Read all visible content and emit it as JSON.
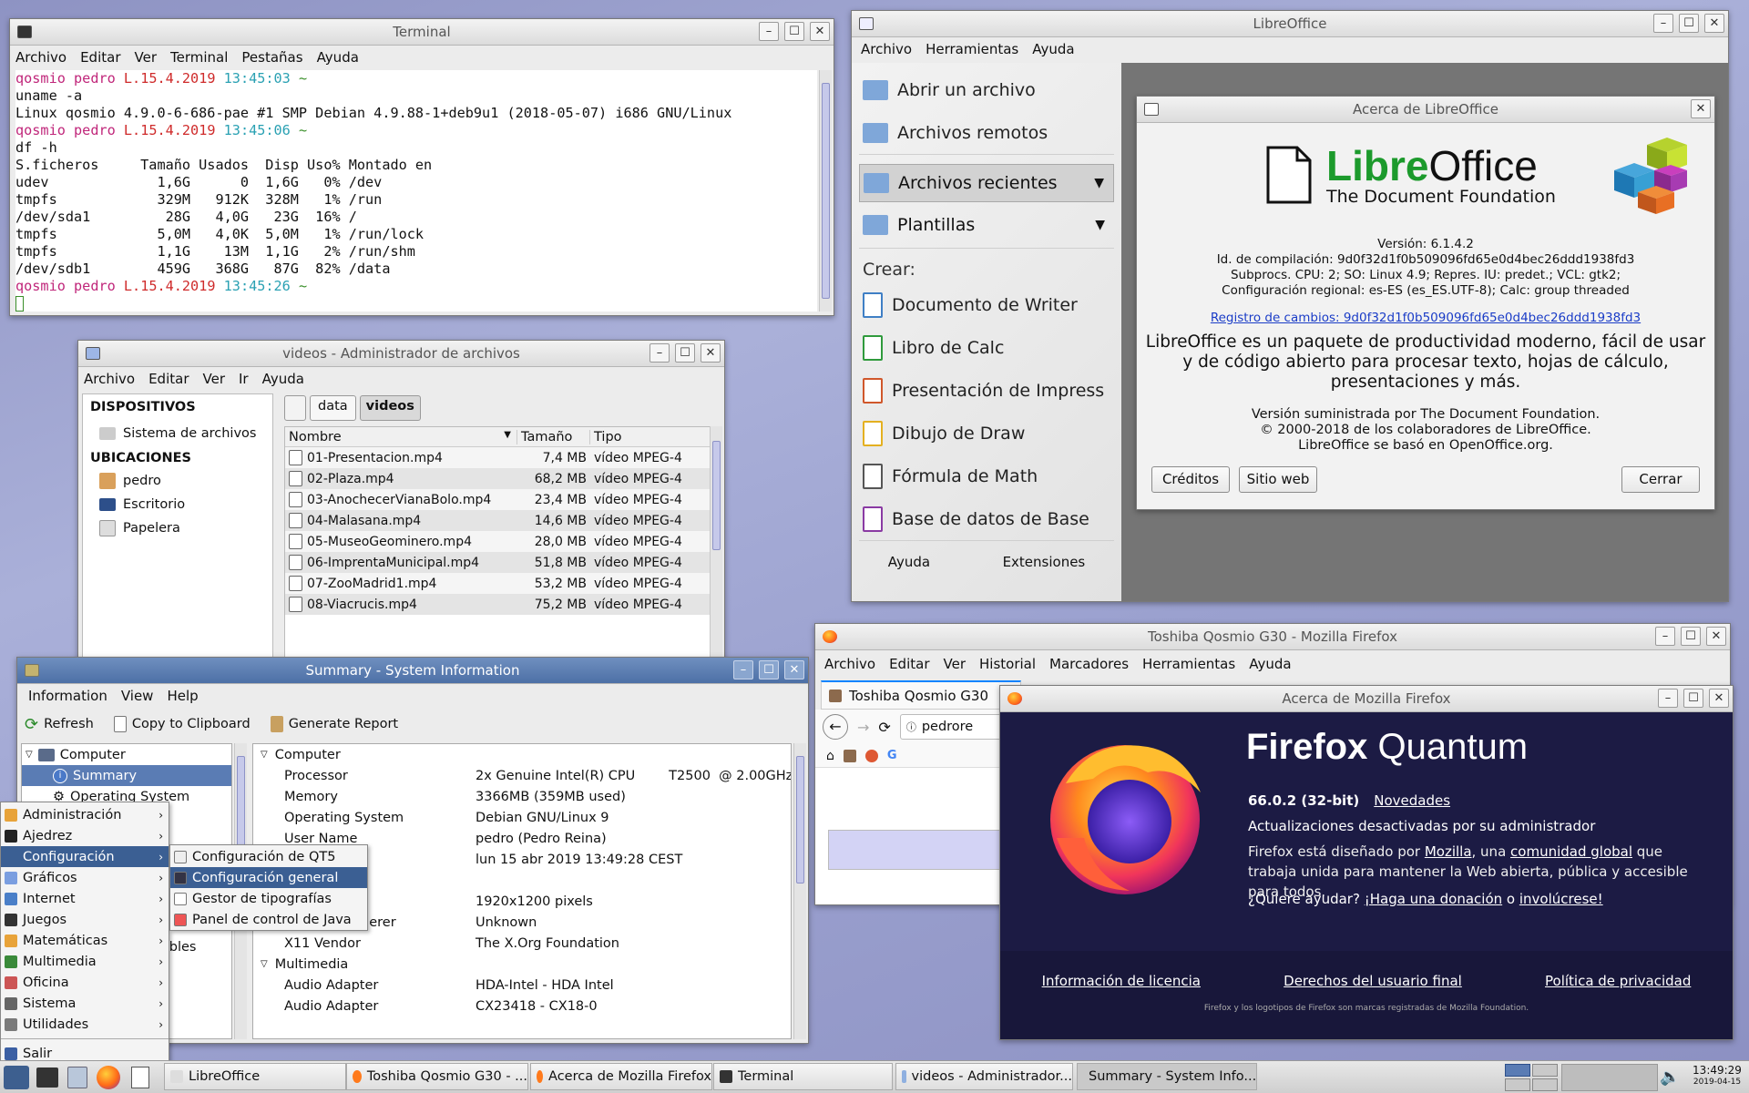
{
  "terminal": {
    "title": "Terminal",
    "menu": [
      "Archivo",
      "Editar",
      "Ver",
      "Terminal",
      "Pestañas",
      "Ayuda"
    ],
    "lines": [
      {
        "host": "qosmio",
        "user": "pedro",
        "tag": "L.15.4.2019",
        "time": "13:45:03",
        "dir": "~"
      },
      {
        "text": "uname -a"
      },
      {
        "text": "Linux qosmio 4.9.0-6-686-pae #1 SMP Debian 4.9.88-1+deb9u1 (2018-05-07) i686 GNU/Linux"
      },
      {
        "host": "qosmio",
        "user": "pedro",
        "tag": "L.15.4.2019",
        "time": "13:45:06",
        "dir": "~"
      },
      {
        "text": "df -h"
      },
      {
        "text": "S.ficheros     Tamaño Usados  Disp Uso% Montado en"
      },
      {
        "text": "udev             1,6G      0  1,6G   0% /dev"
      },
      {
        "text": "tmpfs            329M   912K  328M   1% /run"
      },
      {
        "text": "/dev/sda1         28G   4,0G   23G  16% /"
      },
      {
        "text": "tmpfs            5,0M   4,0K  5,0M   1% /run/lock"
      },
      {
        "text": "tmpfs            1,1G    13M  1,1G   2% /run/shm"
      },
      {
        "text": "/dev/sdb1        459G   368G   87G  82% /data"
      },
      {
        "host": "qosmio",
        "user": "pedro",
        "tag": "L.15.4.2019",
        "time": "13:45:26",
        "dir": "~"
      }
    ]
  },
  "filemanager": {
    "title": "videos - Administrador de archivos",
    "menu": [
      "Archivo",
      "Editar",
      "Ver",
      "Ir",
      "Ayuda"
    ],
    "sidebar": {
      "devices_header": "DISPOSITIVOS",
      "devices": [
        "Sistema de archivos"
      ],
      "places_header": "UBICACIONES",
      "places": [
        "pedro",
        "Escritorio",
        "Papelera"
      ]
    },
    "path": [
      "data",
      "videos"
    ],
    "columns": [
      "Nombre",
      "Tamaño",
      "Tipo"
    ],
    "files": [
      {
        "name": "01-Presentacion.mp4",
        "size": "7,4 MB",
        "type": "vídeo MPEG-4"
      },
      {
        "name": "02-Plaza.mp4",
        "size": "68,2 MB",
        "type": "vídeo MPEG-4"
      },
      {
        "name": "03-AnochecerVianaBolo.mp4",
        "size": "23,4 MB",
        "type": "vídeo MPEG-4"
      },
      {
        "name": "04-Malasana.mp4",
        "size": "14,6 MB",
        "type": "vídeo MPEG-4"
      },
      {
        "name": "05-MuseoGeominero.mp4",
        "size": "28,0 MB",
        "type": "vídeo MPEG-4"
      },
      {
        "name": "06-ImprentaMunicipal.mp4",
        "size": "51,8 MB",
        "type": "vídeo MPEG-4"
      },
      {
        "name": "07-ZooMadrid1.mp4",
        "size": "53,2 MB",
        "type": "vídeo MPEG-4"
      },
      {
        "name": "08-Viacrucis.mp4",
        "size": "75,2 MB",
        "type": "vídeo MPEG-4"
      }
    ]
  },
  "libreoffice": {
    "title": "LibreOffice",
    "menu": [
      "Archivo",
      "Herramientas",
      "Ayuda"
    ],
    "start": [
      "Abrir un archivo",
      "Archivos remotos"
    ],
    "recent": "Archivos recientes",
    "templates": "Plantillas",
    "create_header": "Crear:",
    "create": [
      "Documento de Writer",
      "Libro de Calc",
      "Presentación de Impress",
      "Dibujo de Draw",
      "Fórmula de Math",
      "Base de datos de Base"
    ],
    "footer": [
      "Ayuda",
      "Extensiones"
    ]
  },
  "lo_about": {
    "title": "Acerca de LibreOffice",
    "logo_a": "Libre",
    "logo_b": "Office",
    "foundation": "The Document Foundation",
    "info": [
      "Versión: 6.1.4.2",
      "Id. de compilación: 9d0f32d1f0b509096fd65e0d4bec26ddd1938fd3",
      "Subprocs. CPU: 2; SO: Linux 4.9; Repres. IU: predet.; VCL: gtk2;",
      "Configuración regional: es-ES (es_ES.UTF-8); Calc: group threaded"
    ],
    "link": "Registro de cambios: 9d0f32d1f0b509096fd65e0d4bec26ddd1938fd3",
    "desc": "LibreOffice es un paquete de productividad moderno, fácil de usar y de código abierto para procesar texto, hojas de cálculo, presentaciones y más.",
    "credits": [
      "Versión suministrada por The Document Foundation.",
      "© 2000-2018 de los colaboradores de LibreOffice.",
      "LibreOffice se basó en OpenOffice.org."
    ],
    "buttons": {
      "credits": "Créditos",
      "website": "Sitio web",
      "close": "Cerrar"
    }
  },
  "firefox": {
    "title": "Toshiba Qosmio G30 - Mozilla Firefox",
    "menu": [
      "Archivo",
      "Editar",
      "Ver",
      "Historial",
      "Marcadores",
      "Herramientas",
      "Ayuda"
    ],
    "tab": "Toshiba Qosmio G30",
    "url": "pedrore"
  },
  "ff_about": {
    "title": "Acerca de Mozilla Firefox",
    "brand_a": "Firefox",
    "brand_b": "Quantum",
    "version": "66.0.2 (32-bit)",
    "whatsnew": "Novedades",
    "updates": "Actualizaciones desactivadas por su administrador",
    "p1_a": "Firefox está diseñado por ",
    "p1_link1": "Mozilla",
    "p1_b": ", una ",
    "p1_link2": "comunidad global",
    "p1_c": " que trabaja unida para mantener la Web abierta, pública y accesible para todos.",
    "help_a": "¿Quiere ayudar? ",
    "help_link1": "¡Haga una donación",
    "help_b": " o ",
    "help_link2": "involúcrese!",
    "links": [
      "Información de licencia",
      "Derechos del usuario final",
      "Política de privacidad"
    ],
    "trademark": "Firefox y los logotipos de Firefox son marcas registradas de Mozilla Foundation."
  },
  "sysinfo": {
    "title": "Summary - System Information",
    "menu": [
      "Information",
      "View",
      "Help"
    ],
    "toolbar": [
      "Refresh",
      "Copy to Clipboard",
      "Generate Report"
    ],
    "tree": [
      "Computer",
      "Summary",
      "Operating System"
    ],
    "rows": [
      {
        "k": "Computer",
        "v": "",
        "h": true
      },
      {
        "k": "Processor",
        "v": "2x Genuine Intel(R) CPU        T2500  @ 2.00GHz"
      },
      {
        "k": "Memory",
        "v": "3366MB (359MB used)"
      },
      {
        "k": "Operating System",
        "v": "Debian GNU/Linux 9"
      },
      {
        "k": "User Name",
        "v": "pedro (Pedro Reina)"
      },
      {
        "k": "",
        "v": "lun 15 abr 2019 13:49:28 CEST"
      },
      {
        "k": "",
        "v": ""
      },
      {
        "k": "",
        "v": "1920x1200 pixels"
      },
      {
        "k": "derer",
        "v": "Unknown"
      },
      {
        "k": "X11 Vendor",
        "v": "The X.Org Foundation"
      },
      {
        "k": "Multimedia",
        "v": "",
        "h": true
      },
      {
        "k": "Audio Adapter",
        "v": "HDA-Intel - HDA Intel"
      },
      {
        "k": "Audio Adapter",
        "v": "CX23418 - CX18-0"
      }
    ],
    "behind_fragments": [
      "es",
      "ariables"
    ]
  },
  "startmenu": {
    "items": [
      "Administración",
      "Ajedrez",
      "Configuración",
      "Gráficos",
      "Internet",
      "Juegos",
      "Matemáticas",
      "Multimedia",
      "Oficina",
      "Sistema",
      "Utilidades"
    ],
    "exit": "Salir",
    "submenu": [
      "Configuración de QT5",
      "Configuración general",
      "Gestor de tipografías",
      "Panel de control de Java"
    ]
  },
  "taskbar": {
    "tasks": [
      "LibreOffice",
      "Toshiba Qosmio G30 - ...",
      "Acerca de Mozilla Firefox",
      "Terminal",
      "videos - Administrador...",
      "Summary - System Info..."
    ],
    "time": "13:49:29",
    "date": "2019-04-15"
  }
}
